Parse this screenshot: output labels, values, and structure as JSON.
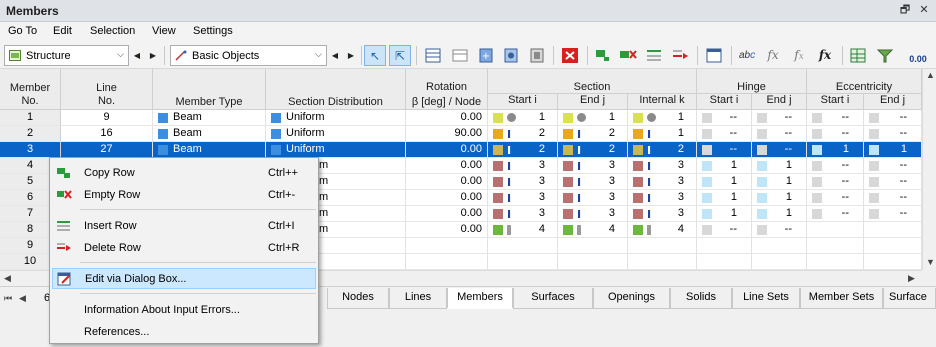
{
  "window": {
    "title": "Members"
  },
  "menu": [
    "Go To",
    "Edit",
    "Selection",
    "View",
    "Settings"
  ],
  "toolbar": {
    "structure_combo": "Structure",
    "objects_combo": "Basic Objects",
    "zero_label": "0.00",
    "fx_label": "fx"
  },
  "table": {
    "group_headers": {
      "rotation": "Rotation",
      "section": "Section",
      "hinge": "Hinge",
      "eccentricity": "Eccentricity"
    },
    "headers": {
      "member_no_1": "Member",
      "member_no_2": "No.",
      "line_no_1": "Line",
      "line_no_2": "No.",
      "member_type": "Member Type",
      "section_distribution": "Section Distribution",
      "rotation_sub": "β [deg] / Node",
      "section_start": "Start i",
      "section_end": "End j",
      "section_internal": "Internal k",
      "hinge_start": "Start i",
      "hinge_end": "End j",
      "ecc_start": "Start i",
      "ecc_end": "End j"
    },
    "rows": [
      {
        "no": "1",
        "line": "9",
        "type": "Beam",
        "dist": "Uniform",
        "rot": "0.00",
        "si": "1",
        "sj": "1",
        "sk": "1",
        "hi": "--",
        "hj": "--",
        "ei": "--",
        "ej": "--",
        "kind": "circle",
        "color": "#d9e150"
      },
      {
        "no": "2",
        "line": "16",
        "type": "Beam",
        "dist": "Uniform",
        "rot": "90.00",
        "si": "2",
        "sj": "2",
        "sk": "1",
        "hi": "--",
        "hj": "--",
        "ei": "--",
        "ej": "--",
        "kind": "ibeam",
        "color": "#e8a820"
      },
      {
        "no": "3",
        "line": "27",
        "type": "Beam",
        "dist": "Uniform",
        "rot": "0.00",
        "si": "2",
        "sj": "2",
        "sk": "2",
        "hi": "--",
        "hj": "--",
        "ei": "1",
        "ej": "1",
        "kind": "ibeam",
        "color": "#c7b65a"
      },
      {
        "no": "4",
        "line": "",
        "type": "",
        "dist": "m",
        "rot": "0.00",
        "si": "3",
        "sj": "3",
        "sk": "3",
        "hi": "1",
        "hj": "1",
        "ei": "--",
        "ej": "--",
        "kind": "ibeam",
        "color": "#b87070"
      },
      {
        "no": "5",
        "line": "",
        "type": "",
        "dist": "m",
        "rot": "0.00",
        "si": "3",
        "sj": "3",
        "sk": "3",
        "hi": "1",
        "hj": "1",
        "ei": "--",
        "ej": "--",
        "kind": "ibeam",
        "color": "#b87070"
      },
      {
        "no": "6",
        "line": "",
        "type": "",
        "dist": "m",
        "rot": "0.00",
        "si": "3",
        "sj": "3",
        "sk": "3",
        "hi": "1",
        "hj": "1",
        "ei": "--",
        "ej": "--",
        "kind": "ibeam",
        "color": "#b87070"
      },
      {
        "no": "7",
        "line": "",
        "type": "",
        "dist": "m",
        "rot": "0.00",
        "si": "3",
        "sj": "3",
        "sk": "3",
        "hi": "1",
        "hj": "1",
        "ei": "--",
        "ej": "--",
        "kind": "ibeam",
        "color": "#b87070"
      },
      {
        "no": "8",
        "line": "",
        "type": "",
        "dist": "m",
        "rot": "0.00",
        "si": "4",
        "sj": "4",
        "sk": "4",
        "hi": "--",
        "hj": "--",
        "ei": "",
        "ej": "",
        "kind": "bar",
        "color": "#6cb83a"
      },
      {
        "no": "9",
        "line": "",
        "type": "",
        "dist": "",
        "rot": "",
        "si": "",
        "sj": "",
        "sk": "",
        "hi": "",
        "hj": "",
        "ei": "",
        "ej": "",
        "kind": "none",
        "color": "#ffffff"
      },
      {
        "no": "10",
        "line": "",
        "type": "",
        "dist": "",
        "rot": "",
        "si": "",
        "sj": "",
        "sk": "",
        "hi": "",
        "hj": "",
        "ei": "",
        "ej": "",
        "kind": "none",
        "color": "#ffffff"
      }
    ],
    "selected_row": 2
  },
  "pager": {
    "page_label": "6"
  },
  "tabs": [
    "Nodes",
    "Lines",
    "Members",
    "Surfaces",
    "Openings",
    "Solids",
    "Line Sets",
    "Member Sets",
    "Surface Se"
  ],
  "active_tab": "Members",
  "context_menu": {
    "items": [
      {
        "label": "Copy Row",
        "shortcut": "Ctrl++"
      },
      {
        "label": "Empty Row",
        "shortcut": "Ctrl+-"
      },
      {
        "label": "Insert Row",
        "shortcut": "Ctrl+I"
      },
      {
        "label": "Delete Row",
        "shortcut": "Ctrl+R"
      },
      {
        "label": "Edit via Dialog Box...",
        "shortcut": ""
      },
      {
        "label": "Information About Input Errors...",
        "shortcut": ""
      },
      {
        "label": "References...",
        "shortcut": ""
      }
    ]
  },
  "colors": {
    "selection": "#0a64c8",
    "member_blue": "#3c8fe0",
    "menu_highlight": "#cce8ff"
  }
}
